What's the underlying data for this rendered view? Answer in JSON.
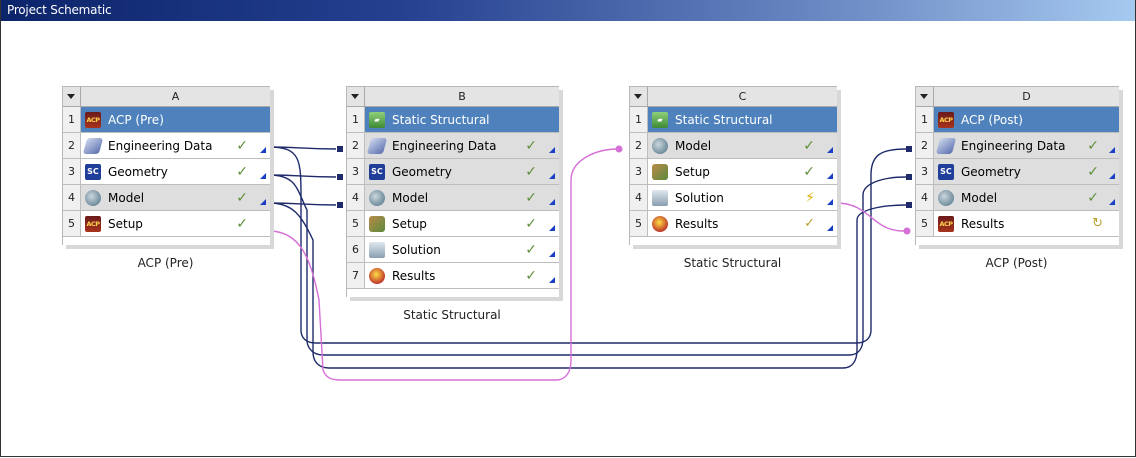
{
  "window": {
    "title": "Project Schematic"
  },
  "systems": [
    {
      "letter": "A",
      "caption": "ACP (Pre)",
      "rows": [
        {
          "num": "1",
          "icon": "acp-icon",
          "icon_text": "ACP",
          "label": "ACP (Pre)",
          "status": ""
        },
        {
          "num": "2",
          "icon": "engineering-data-icon",
          "icon_text": "",
          "label": "Engineering Data",
          "status": "✓"
        },
        {
          "num": "3",
          "icon": "geometry-icon",
          "icon_text": "SC",
          "label": "Geometry",
          "status": "✓"
        },
        {
          "num": "4",
          "icon": "model-icon",
          "icon_text": "",
          "label": "Model",
          "status": "✓"
        },
        {
          "num": "5",
          "icon": "acp-icon",
          "icon_text": "ACP",
          "label": "Setup",
          "status": "✓"
        }
      ]
    },
    {
      "letter": "B",
      "caption": "Static Structural",
      "rows": [
        {
          "num": "1",
          "icon": "static-structural-icon",
          "icon_text": "▰",
          "label": "Static Structural",
          "status": ""
        },
        {
          "num": "2",
          "icon": "engineering-data-icon",
          "icon_text": "",
          "label": "Engineering Data",
          "status": "✓"
        },
        {
          "num": "3",
          "icon": "geometry-icon",
          "icon_text": "SC",
          "label": "Geometry",
          "status": "✓"
        },
        {
          "num": "4",
          "icon": "model-icon",
          "icon_text": "",
          "label": "Model",
          "status": "✓"
        },
        {
          "num": "5",
          "icon": "setup-icon",
          "icon_text": "",
          "label": "Setup",
          "status": "✓"
        },
        {
          "num": "6",
          "icon": "solution-icon",
          "icon_text": "",
          "label": "Solution",
          "status": "✓"
        },
        {
          "num": "7",
          "icon": "results-icon",
          "icon_text": "",
          "label": "Results",
          "status": "✓"
        }
      ]
    },
    {
      "letter": "C",
      "caption": "Static Structural",
      "rows": [
        {
          "num": "1",
          "icon": "static-structural-icon",
          "icon_text": "▰",
          "label": "Static Structural",
          "status": ""
        },
        {
          "num": "2",
          "icon": "model-icon",
          "icon_text": "",
          "label": "Model",
          "status": "✓"
        },
        {
          "num": "3",
          "icon": "setup-icon",
          "icon_text": "",
          "label": "Setup",
          "status": "✓"
        },
        {
          "num": "4",
          "icon": "solution-icon",
          "icon_text": "",
          "label": "Solution",
          "status": "⚡"
        },
        {
          "num": "5",
          "icon": "results-icon",
          "icon_text": "",
          "label": "Results",
          "status": "✓"
        }
      ]
    },
    {
      "letter": "D",
      "caption": "ACP (Post)",
      "rows": [
        {
          "num": "1",
          "icon": "acp-icon",
          "icon_text": "ACP",
          "label": "ACP (Post)",
          "status": ""
        },
        {
          "num": "2",
          "icon": "engineering-data-icon",
          "icon_text": "",
          "label": "Engineering Data",
          "status": "✓"
        },
        {
          "num": "3",
          "icon": "geometry-icon",
          "icon_text": "SC",
          "label": "Geometry",
          "status": "✓"
        },
        {
          "num": "4",
          "icon": "model-icon",
          "icon_text": "",
          "label": "Model",
          "status": "✓"
        },
        {
          "num": "5",
          "icon": "acp-icon",
          "icon_text": "ACP",
          "label": "Results",
          "status": "↻"
        }
      ]
    }
  ],
  "colors": {
    "link_share": "#1f2a6b",
    "link_transfer": "#d66fd6",
    "header_blue": "#4f82bd",
    "check_green": "#5e8f3a"
  }
}
